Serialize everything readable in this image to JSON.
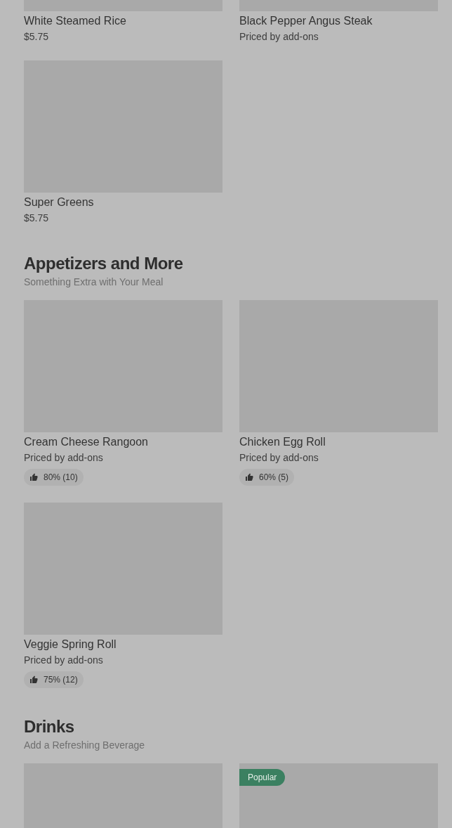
{
  "sections": [
    {
      "items": [
        {
          "kind": "picture",
          "name": "White Steamed Rice",
          "price": "$5.75"
        },
        {
          "kind": "picture",
          "name": "Black Pepper Angus Steak",
          "price": "Priced by add-ons"
        },
        {
          "kind": "picture",
          "name": "Super Greens",
          "price": "$5.75"
        }
      ]
    },
    {
      "title": "Appetizers and More",
      "subtitle": "Something Extra with Your Meal",
      "items": [
        {
          "kind": "picture",
          "name": "Cream Cheese Rangoon",
          "price": "Priced by add-ons",
          "rating": "80% (10)"
        },
        {
          "kind": "picture",
          "name": "Chicken Egg Roll",
          "price": "Priced by add-ons",
          "rating": "60% (5)"
        },
        {
          "kind": "picture",
          "name": "Veggie Spring Roll",
          "price": "Priced by add-ons",
          "rating": "75% (12)"
        }
      ]
    },
    {
      "title": "Drinks",
      "subtitle": "Add a Refreshing Beverage",
      "items": [
        {
          "kind": "picture"
        },
        {
          "kind": "picture",
          "badge": "Popular"
        }
      ]
    }
  ]
}
